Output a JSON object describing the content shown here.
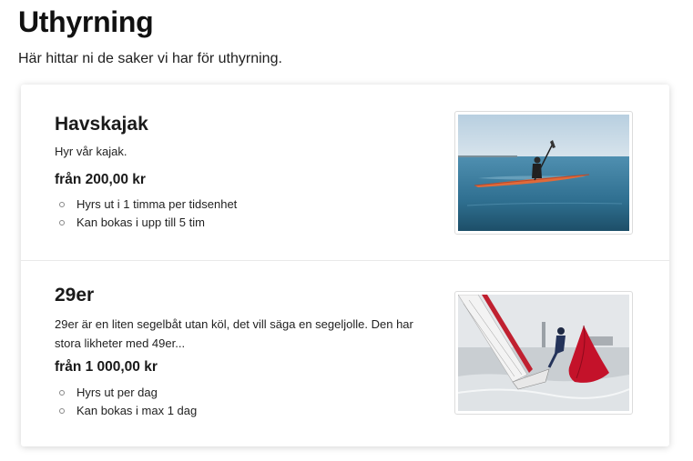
{
  "page": {
    "title": "Uthyrning",
    "intro": "Här hittar ni de saker vi har för uthyrning."
  },
  "items": [
    {
      "title": "Havskajak",
      "description": "Hyr vår kajak.",
      "price": "från 200,00 kr",
      "features": [
        "Hyrs ut i 1 timma per tidsenhet",
        "Kan bokas i upp till 5 tim"
      ],
      "image": "kayak-photo"
    },
    {
      "title": "29er",
      "description": "29er är en liten segelbåt utan köl, det vill säga en segeljolle. Den har stora likheter med 49er...",
      "price": "från 1 000,00 kr",
      "features": [
        "Hyrs ut per dag",
        "Kan bokas i max 1 dag"
      ],
      "image": "sailboat-photo"
    }
  ]
}
